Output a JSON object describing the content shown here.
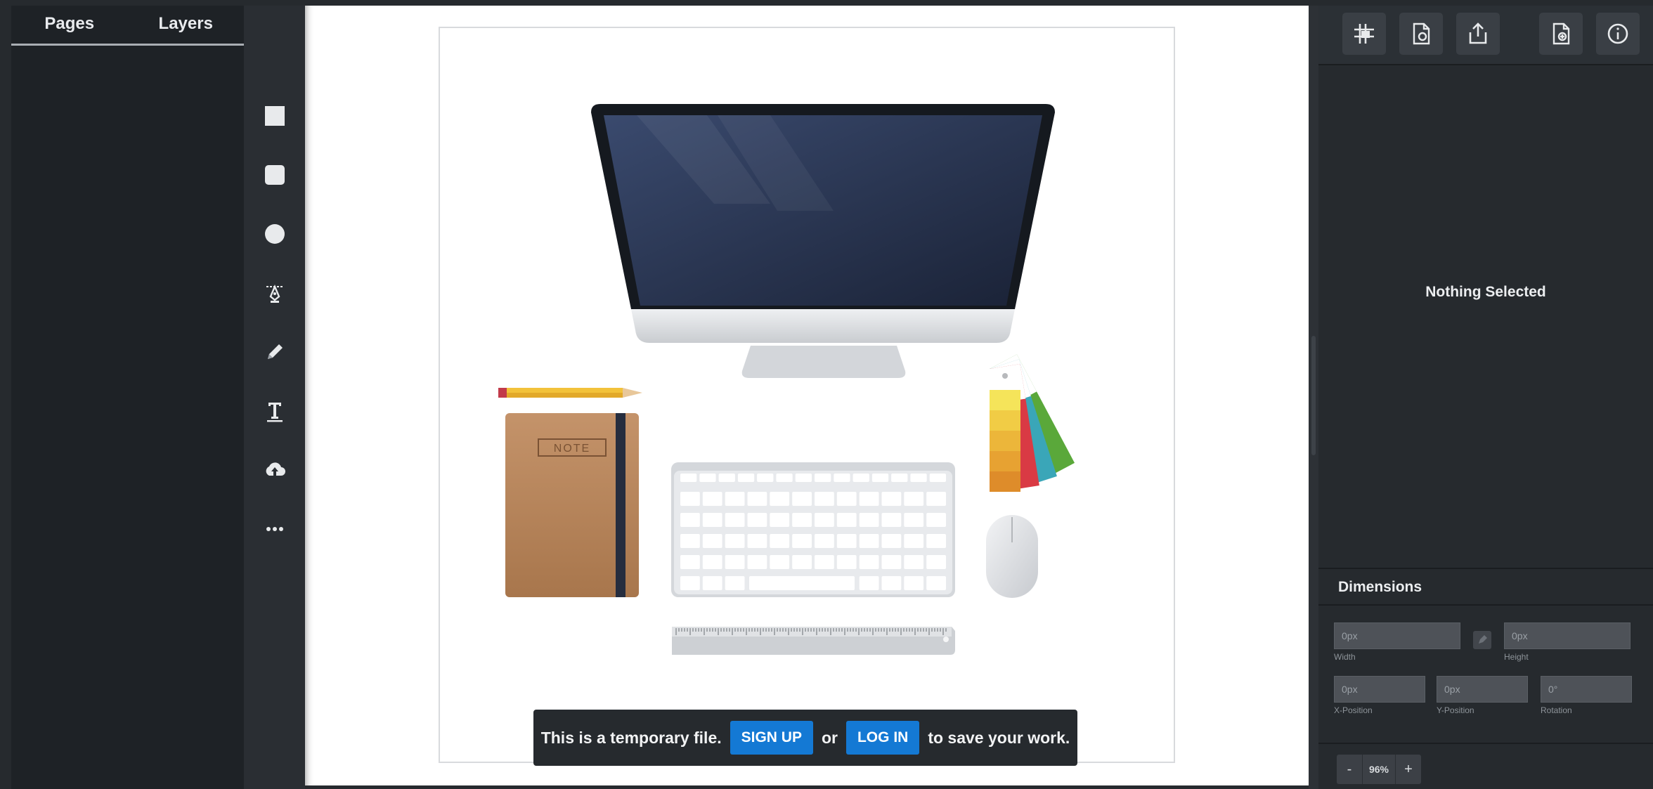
{
  "left_panel": {
    "tabs": [
      "Pages",
      "Layers"
    ]
  },
  "tools": [
    "square-tool-icon",
    "rounded-square-tool-icon",
    "circle-tool-icon",
    "pen-tool-icon",
    "pencil-tool-icon",
    "text-tool-icon",
    "upload-tool-icon",
    "more-tools-icon"
  ],
  "canvas": {
    "notebook_label": "NOTE",
    "banner": {
      "text_before": "This is a temporary file.",
      "signup_label": "SIGN UP",
      "or_text": "or",
      "login_label": "LOG IN",
      "text_after": "to save your work."
    }
  },
  "toolbar_icons": [
    "grid-icon",
    "page-settings-icon",
    "export-icon",
    "page-add-icon",
    "info-icon"
  ],
  "selection": {
    "empty_text": "Nothing Selected"
  },
  "dimensions": {
    "title": "Dimensions",
    "width": {
      "value": "0px",
      "label": "Width"
    },
    "height": {
      "value": "0px",
      "label": "Height"
    },
    "x": {
      "value": "0px",
      "label": "X-Position"
    },
    "y": {
      "value": "0px",
      "label": "Y-Position"
    },
    "rotation": {
      "value": "0°",
      "label": "Rotation"
    }
  },
  "zoom": {
    "minus": "-",
    "value": "96%",
    "plus": "+"
  },
  "colors": {
    "accent": "#1479d4",
    "panel": "#262a2e",
    "canvas": "#ffffff"
  }
}
